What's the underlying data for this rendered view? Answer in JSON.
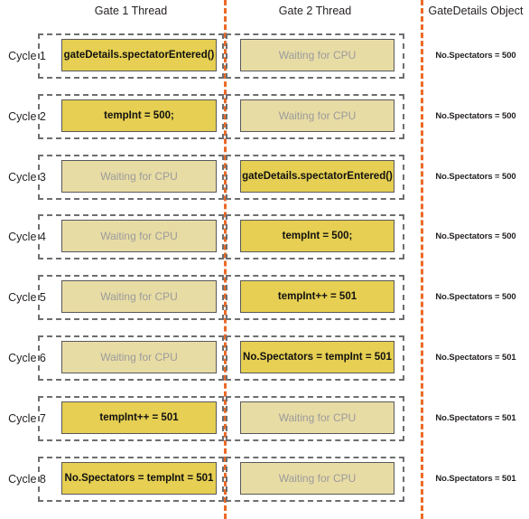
{
  "headers": {
    "gate1": "Gate 1 Thread",
    "gate2": "Gate 2 Thread",
    "object": "GateDetails Object"
  },
  "rows": [
    {
      "cycle": "Cycle 1",
      "gate1": {
        "text": "gateDetails.spectatorEntered()",
        "state": "active"
      },
      "gate2": {
        "text": "Waiting for CPU",
        "state": "waiting"
      },
      "object": "No.Spectators  = 500"
    },
    {
      "cycle": "Cycle 2",
      "gate1": {
        "text": "tempInt = 500;",
        "state": "active"
      },
      "gate2": {
        "text": "Waiting for CPU",
        "state": "waiting"
      },
      "object": "No.Spectators  = 500"
    },
    {
      "cycle": "Cycle 3",
      "gate1": {
        "text": "Waiting for CPU",
        "state": "waiting"
      },
      "gate2": {
        "text": "gateDetails.spectatorEntered()",
        "state": "active"
      },
      "object": "No.Spectators  = 500"
    },
    {
      "cycle": "Cycle 4",
      "gate1": {
        "text": "Waiting for CPU",
        "state": "waiting"
      },
      "gate2": {
        "text": "tempInt = 500;",
        "state": "active"
      },
      "object": "No.Spectators  = 500"
    },
    {
      "cycle": "Cycle 5",
      "gate1": {
        "text": "Waiting for CPU",
        "state": "waiting"
      },
      "gate2": {
        "text": "tempInt++ = 501",
        "state": "active"
      },
      "object": "No.Spectators  = 500"
    },
    {
      "cycle": "Cycle 6",
      "gate1": {
        "text": "Waiting for CPU",
        "state": "waiting"
      },
      "gate2": {
        "text": "No.Spectators  = tempInt = 501",
        "state": "active"
      },
      "object": "No.Spectators  = 501"
    },
    {
      "cycle": "Cycle 7",
      "gate1": {
        "text": "tempInt++ = 501",
        "state": "active"
      },
      "gate2": {
        "text": "Waiting for CPU",
        "state": "waiting"
      },
      "object": "No.Spectators  = 501"
    },
    {
      "cycle": "Cycle 8",
      "gate1": {
        "text": "No.Spectators  = tempInt = 501",
        "state": "active"
      },
      "gate2": {
        "text": "Waiting for CPU",
        "state": "waiting"
      },
      "object": "No.Spectators  = 501"
    }
  ],
  "colors": {
    "active_fill": "#e6cf52",
    "waiting_fill": "#e8dca5",
    "separator": "#ea6a27",
    "lane_border": "#6d6e71",
    "box_border": "#58585b"
  }
}
